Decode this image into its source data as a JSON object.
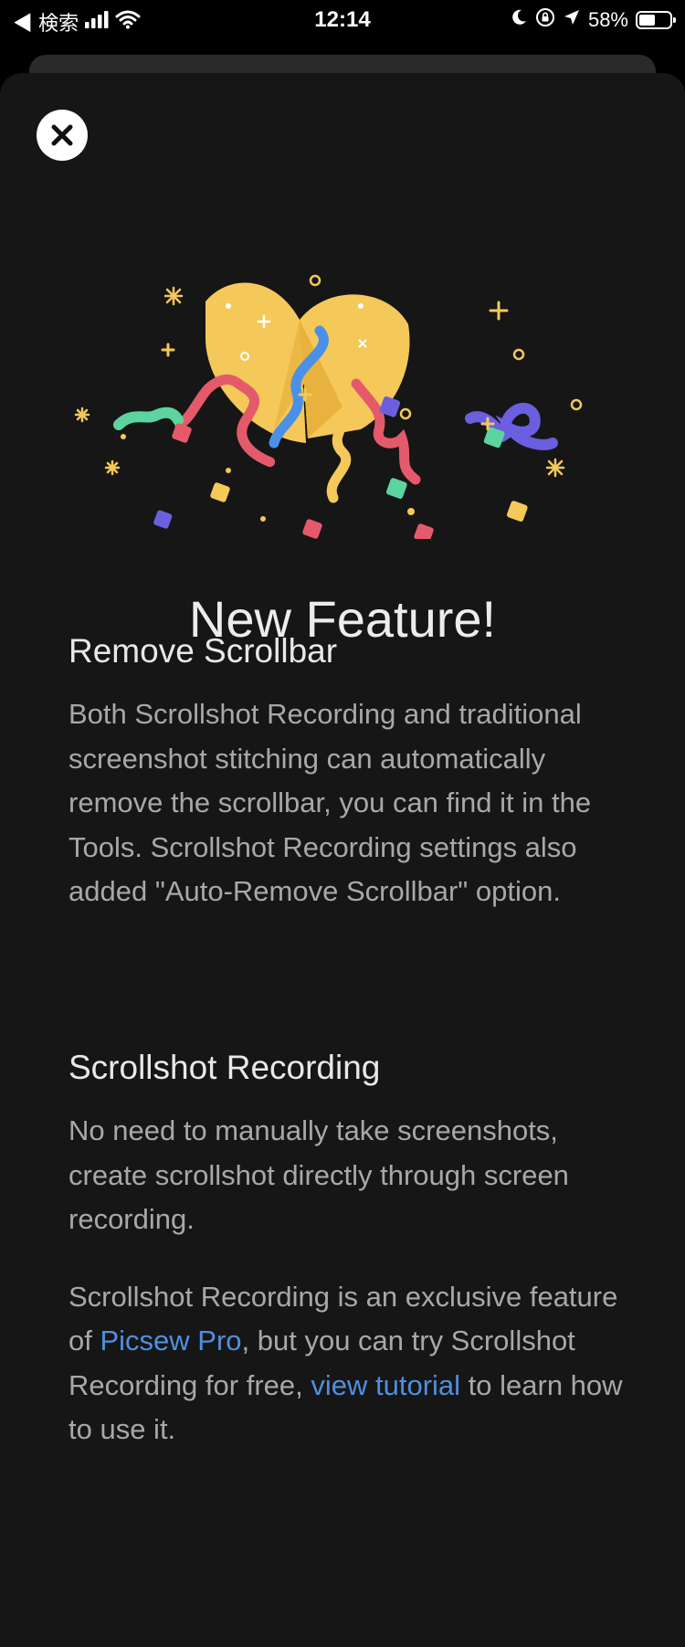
{
  "status_bar": {
    "back_label": "◀ 検索",
    "time": "12:14",
    "battery_text": "58%",
    "battery_level": 0.58
  },
  "modal": {
    "title": "New Feature!",
    "sections": [
      {
        "heading": "Remove Scrollbar",
        "body": "Both Scrollshot Recording and traditional screenshot stitching can automatically remove the scrollbar, you can find it in the Tools. Scrollshot Recording settings also added \"Auto-Remove Scrollbar\" option."
      },
      {
        "heading": "Scrollshot Recording",
        "body": "No need to manually take screenshots, create scrollshot directly through screen recording.",
        "note": {
          "part1": "Scrollshot Recording is an exclusive feature of ",
          "link1": "Picsew Pro",
          "part2": ", but you can try Scrollshot Recording for free, ",
          "link2": "view tutorial",
          "part3": " to learn how to use it."
        }
      }
    ]
  },
  "colors": {
    "background": "#161616",
    "link": "#4f8fe0",
    "cookie": "#f5c85a",
    "confetti": [
      "#f07b7b",
      "#4aa2f0",
      "#6b5fe0",
      "#5cd4a0",
      "#f5c85a",
      "#e55a6a"
    ]
  },
  "icons": [
    "close-icon",
    "signal-icon",
    "wifi-icon",
    "moon-icon",
    "orientation-lock-icon",
    "location-icon",
    "battery-icon",
    "fortune-cookie-confetti-icon"
  ]
}
